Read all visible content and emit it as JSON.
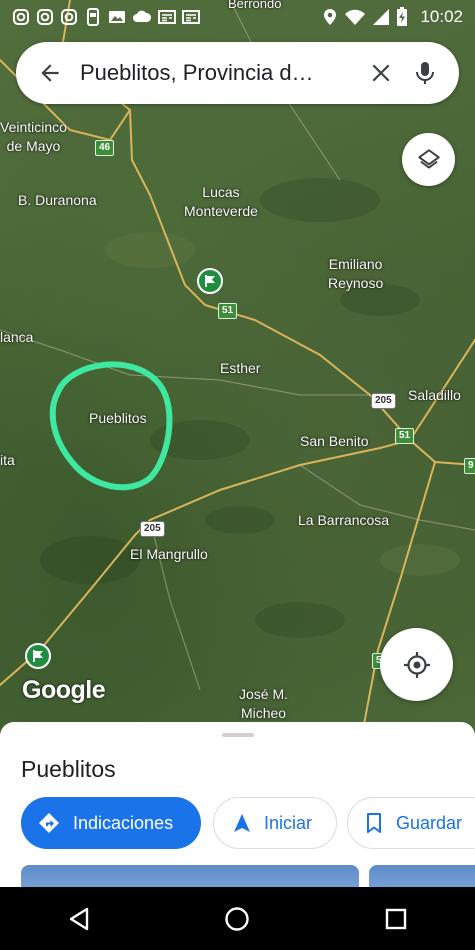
{
  "status_bar": {
    "time": "10:02",
    "left_icons": [
      "instagram-icon",
      "instagram-icon",
      "instagram-icon",
      "phone-message-icon",
      "image-icon",
      "cloud-icon",
      "news-icon",
      "news-icon"
    ],
    "right_icons": [
      "location-icon",
      "wifi-icon",
      "signal-icon",
      "battery-charging-icon"
    ]
  },
  "search": {
    "query": "Pueblitos, Provincia d…",
    "back_icon": "arrow-back-icon",
    "clear_icon": "close-icon",
    "voice_icon": "mic-icon"
  },
  "map": {
    "top_label_partial": "Berrondo",
    "places": [
      {
        "name": "Veinticinco\nde Mayo"
      },
      {
        "name": "B. Duranona"
      },
      {
        "name": "Lucas\nMonteverde"
      },
      {
        "name": "Emiliano\nReynoso"
      },
      {
        "name": "lanca"
      },
      {
        "name": "Esther"
      },
      {
        "name": "Pueblitos"
      },
      {
        "name": "Saladillo"
      },
      {
        "name": "San Benito"
      },
      {
        "name": "ita"
      },
      {
        "name": "La Barrancosa"
      },
      {
        "name": "El Mangrullo"
      },
      {
        "name": "José M.\nMicheo"
      }
    ],
    "route_shields": {
      "r46": "46",
      "r51a": "51",
      "r205a": "205",
      "r51b": "51",
      "r9": "9",
      "r205b": "205",
      "r5": "5"
    },
    "highlight_color": "#3ee8a0",
    "logo": "Google"
  },
  "controls": {
    "layers_icon": "layers-icon",
    "my_location_icon": "my-location-icon"
  },
  "sheet": {
    "title": "Pueblitos",
    "actions": {
      "directions": "Indicaciones",
      "start": "Iniciar",
      "save": "Guardar"
    },
    "accent_color": "#1a73e8"
  },
  "nav_bar": {
    "back_icon": "nav-back-icon",
    "home_icon": "nav-home-icon",
    "recents_icon": "nav-recents-icon"
  }
}
